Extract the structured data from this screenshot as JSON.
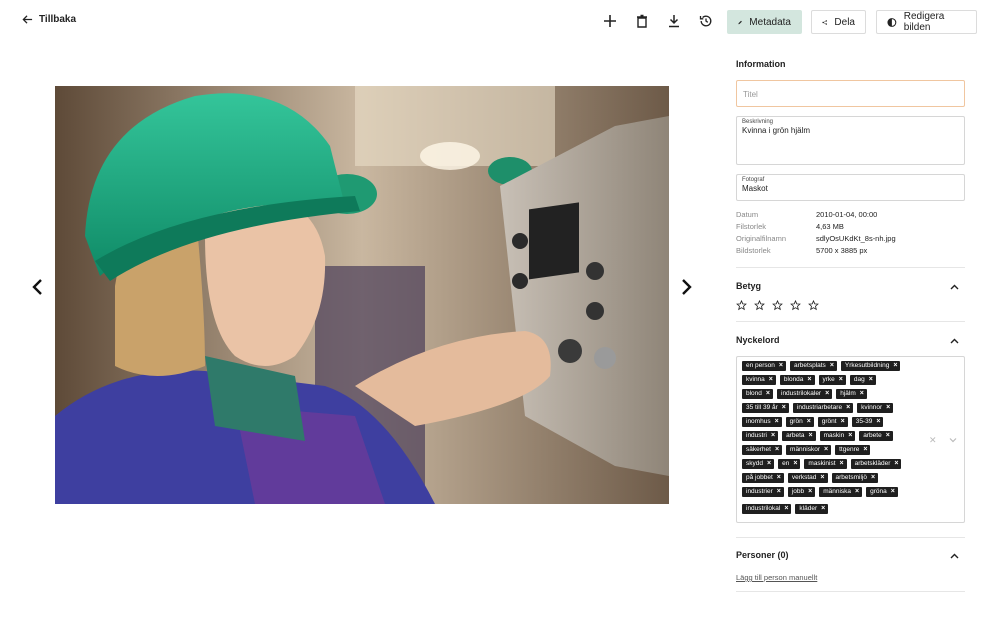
{
  "topbar": {
    "back_label": "Tillbaka",
    "tools": [
      "add-icon",
      "trash-icon",
      "download-icon",
      "history-icon"
    ],
    "metadata_label": "Metadata",
    "share_label": "Dela",
    "edit_label": "Redigera bilden"
  },
  "information": {
    "title": "Information",
    "title_field": {
      "placeholder": "Titel",
      "value": ""
    },
    "description_field": {
      "label": "Beskrivning",
      "value": "Kvinna i grön hjälm"
    },
    "photographer_field": {
      "label": "Fotograf",
      "value": "Maskot"
    },
    "meta": [
      {
        "label": "Datum",
        "value": "2010-01-04, 00:00"
      },
      {
        "label": "Filstorlek",
        "value": "4,63 MB"
      },
      {
        "label": "Originalfilnamn",
        "value": "sdlyOsUKdKt_8s-nh.jpg"
      },
      {
        "label": "Bildstorlek",
        "value": "5700 x 3885 px"
      }
    ]
  },
  "rating": {
    "title": "Betyg",
    "stars_total": 5,
    "stars_filled": 0
  },
  "keywords": {
    "title": "Nyckelord",
    "rows": [
      [
        "en person",
        "arbetsplats",
        "Yrkesutbildning"
      ],
      [
        "kvinna",
        "blonda",
        "yrke",
        "dag"
      ],
      [
        "blond",
        "industrilokaler",
        "hjälm"
      ],
      [
        "35 till 39 år",
        "industriarbetare",
        "kvinnor"
      ],
      [
        "inomhus",
        "grön",
        "grönt",
        "35-39"
      ],
      [
        "industri",
        "arbeta",
        "maskin",
        "arbete"
      ],
      [
        "säkerhet",
        "människor",
        "ttgenre"
      ],
      [
        "skydd",
        "en",
        "maskinist",
        "arbetskläder"
      ],
      [
        "på jobbet",
        "verkstad",
        "arbetsmiljö"
      ],
      [
        "industrier",
        "jobb",
        "människa",
        "gröna"
      ],
      [
        "industrilokal",
        "kläder"
      ]
    ],
    "remove_symbol": "×",
    "clear_symbol": "✕"
  },
  "persons": {
    "title": "Personer (0)",
    "add_link": "Lägg till person manuellt"
  }
}
